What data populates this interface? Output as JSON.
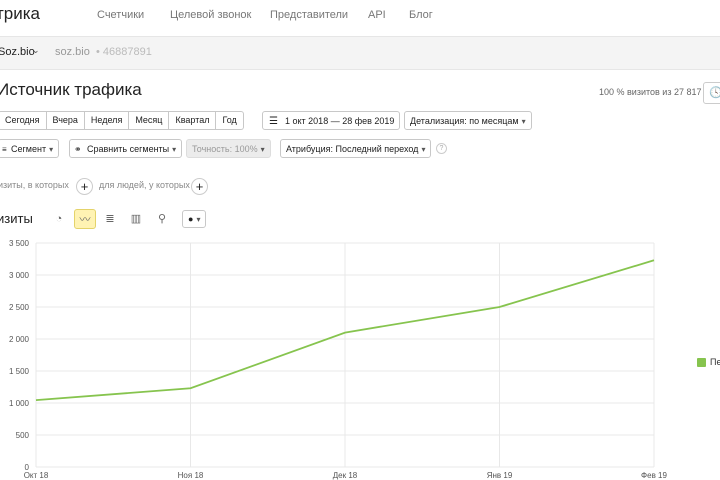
{
  "header": {
    "logo": "трика",
    "nav": [
      "Счетчики",
      "Целевой звонок",
      "Представители",
      "API",
      "Блог"
    ]
  },
  "counter": {
    "name": "Soz.bio",
    "caret": "⌄",
    "site": "soz.bio",
    "separator": "•",
    "id": "46887891"
  },
  "report": {
    "title": "Источник трафика",
    "share": "100 % визитов из 27 817",
    "clock_icon": "clock-icon"
  },
  "periods": [
    "Сегодня",
    "Вчера",
    "Неделя",
    "Месяц",
    "Квартал",
    "Год"
  ],
  "controls": {
    "date_range": "1 окт 2018 — 28 фев 2019",
    "detail": "Детализация: по месяцам",
    "segment": "Сегмент",
    "compare": "Сравнить сегменты",
    "accuracy": "Точность: 100%",
    "attribution": "Атрибуция: Последний переход"
  },
  "filters": {
    "visits_where": "изиты, в которых",
    "people_where": "для людей, у которых",
    "plus": "+"
  },
  "chart_section": {
    "label": "изиты",
    "icons": [
      "pie-chart-icon",
      "line-chart-icon",
      "stacked-area-icon",
      "bar-chart-icon",
      "map-pin-icon",
      "comment-icon"
    ]
  },
  "chart_data": {
    "type": "line",
    "categories": [
      "Окт 18",
      "Ноя 18",
      "Дек 18",
      "Янв 19",
      "Фев 19"
    ],
    "series": [
      {
        "name": "Пе",
        "color": "#86c44e",
        "values": [
          1045,
          1230,
          2100,
          2500,
          3230
        ]
      }
    ],
    "yticks": [
      "3 500",
      "3 000",
      "2 500",
      "2 000",
      "1 500",
      "1 000",
      "500",
      "0"
    ],
    "ylim": [
      0,
      3500
    ],
    "grid": true,
    "legend_position": "right"
  }
}
